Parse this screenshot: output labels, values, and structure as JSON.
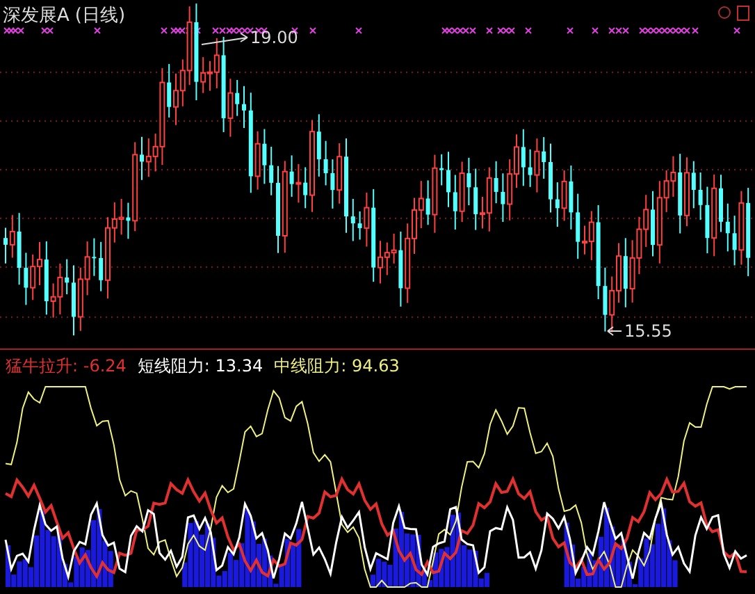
{
  "header": {
    "title": "深发展A",
    "period": "(日线)"
  },
  "price_chart": {
    "high_label": "19.00",
    "low_label": "15.55"
  },
  "indicator_legend": [
    {
      "label": "猛牛拉升: -6.24",
      "color": "#e03030"
    },
    {
      "label": "短线阻力: 13.34",
      "color": "#ffffff"
    },
    {
      "label": "中线阻力: 94.63",
      "color": "#f0f080"
    }
  ]
}
